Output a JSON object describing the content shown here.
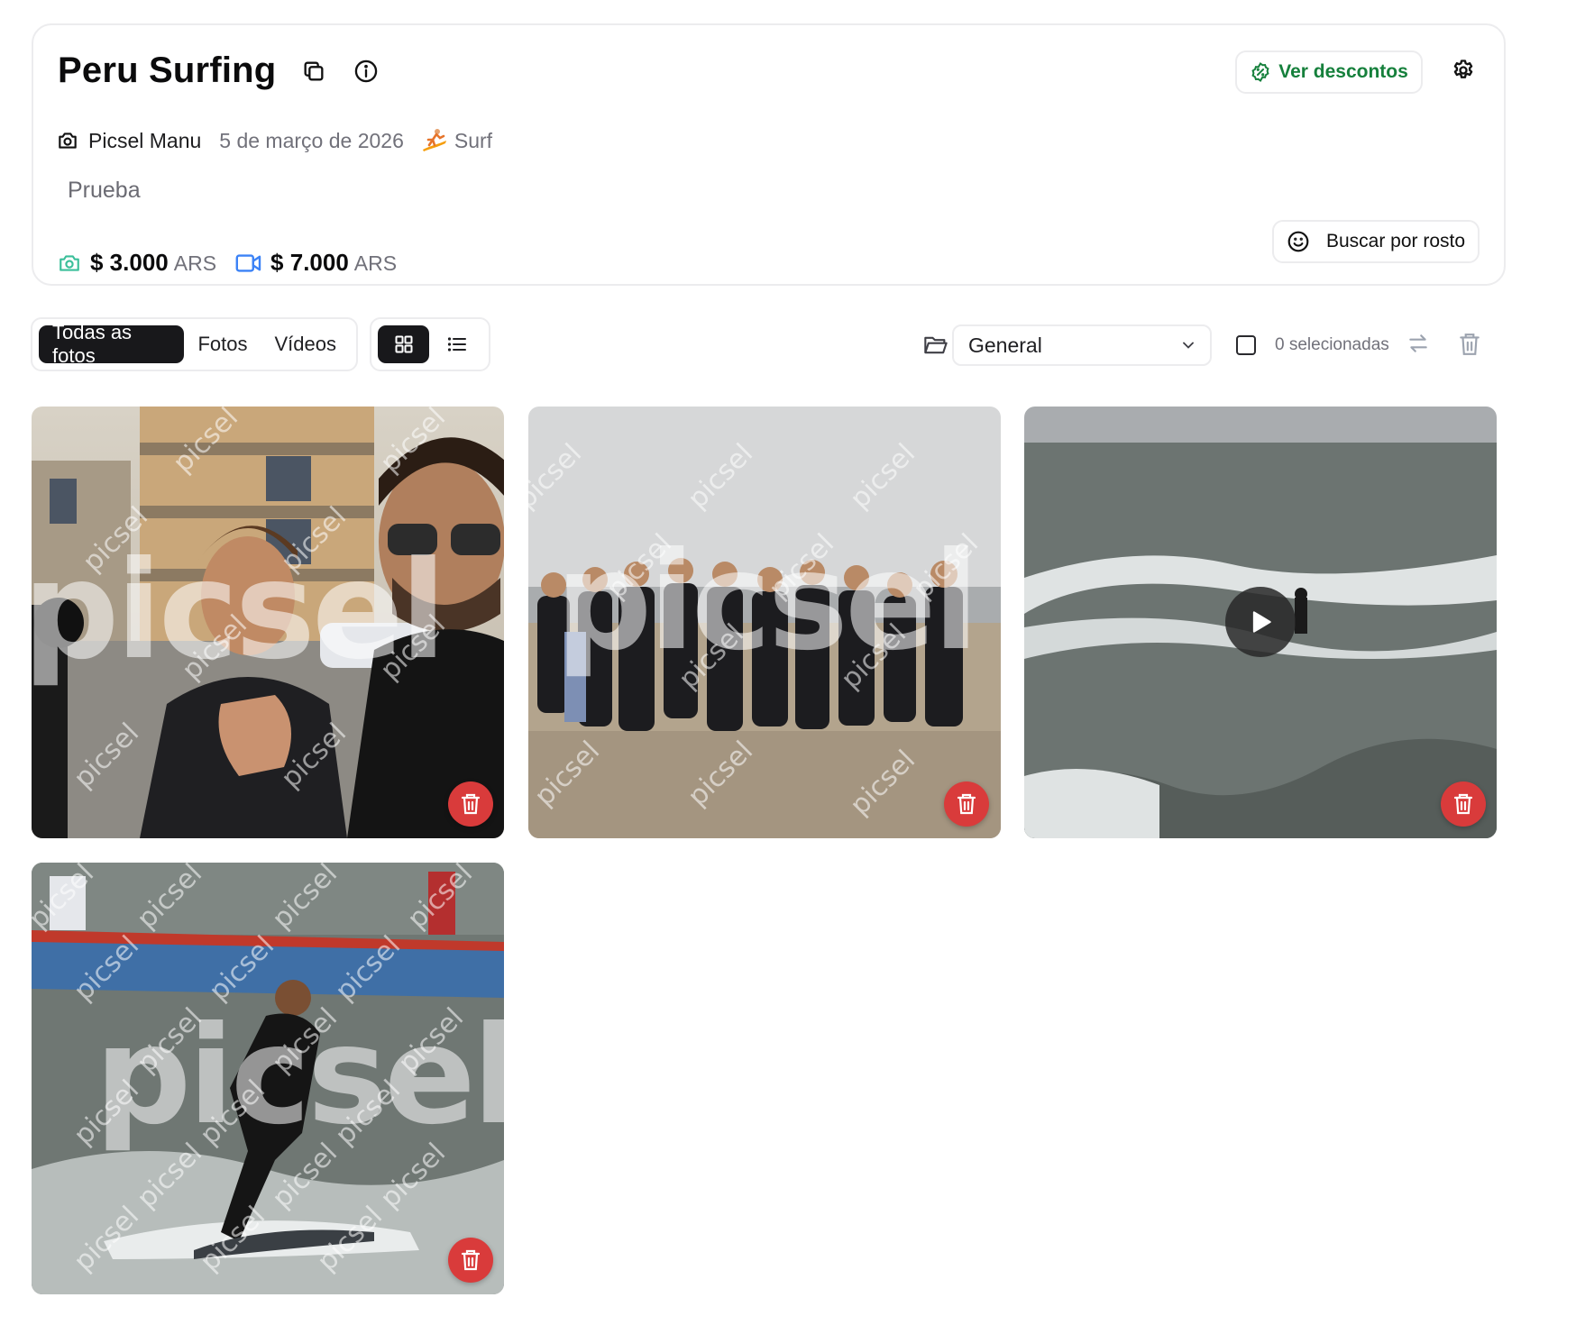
{
  "header": {
    "title": "Peru Surfing",
    "photographer": "Picsel Manu",
    "date": "5 de março de 2026",
    "sport": "Surf",
    "description": "Prueba",
    "discount_label": "Ver descontos",
    "face_search_label": "Buscar por rosto",
    "prices": [
      {
        "icon": "camera-icon",
        "amount": "$ 3.000",
        "currency": "ARS"
      },
      {
        "icon": "video-camera-icon",
        "amount": "$ 7.000",
        "currency": "ARS"
      }
    ]
  },
  "toolbar": {
    "filters": [
      "Todas as fotos",
      "Fotos",
      "Vídeos"
    ],
    "active_filter": "Todas as fotos",
    "view_modes": [
      "grid-icon",
      "list-icon"
    ],
    "active_view": "grid-icon",
    "folder": "General",
    "selected_count": "0 selecionadas"
  },
  "gallery": {
    "watermark": "picsel",
    "items": [
      {
        "type": "photo",
        "subject": "selfie of two men"
      },
      {
        "type": "photo",
        "subject": "group photo on beach"
      },
      {
        "type": "video",
        "subject": "surfer on waves"
      },
      {
        "type": "photo",
        "subject": "surfer riding wave near boat"
      }
    ]
  },
  "colors": {
    "accent_green": "#16803c",
    "camera_teal": "#3bbf9a",
    "video_blue": "#3b82f6",
    "delete_red": "#d93b3b",
    "active_dark": "#18181b"
  }
}
